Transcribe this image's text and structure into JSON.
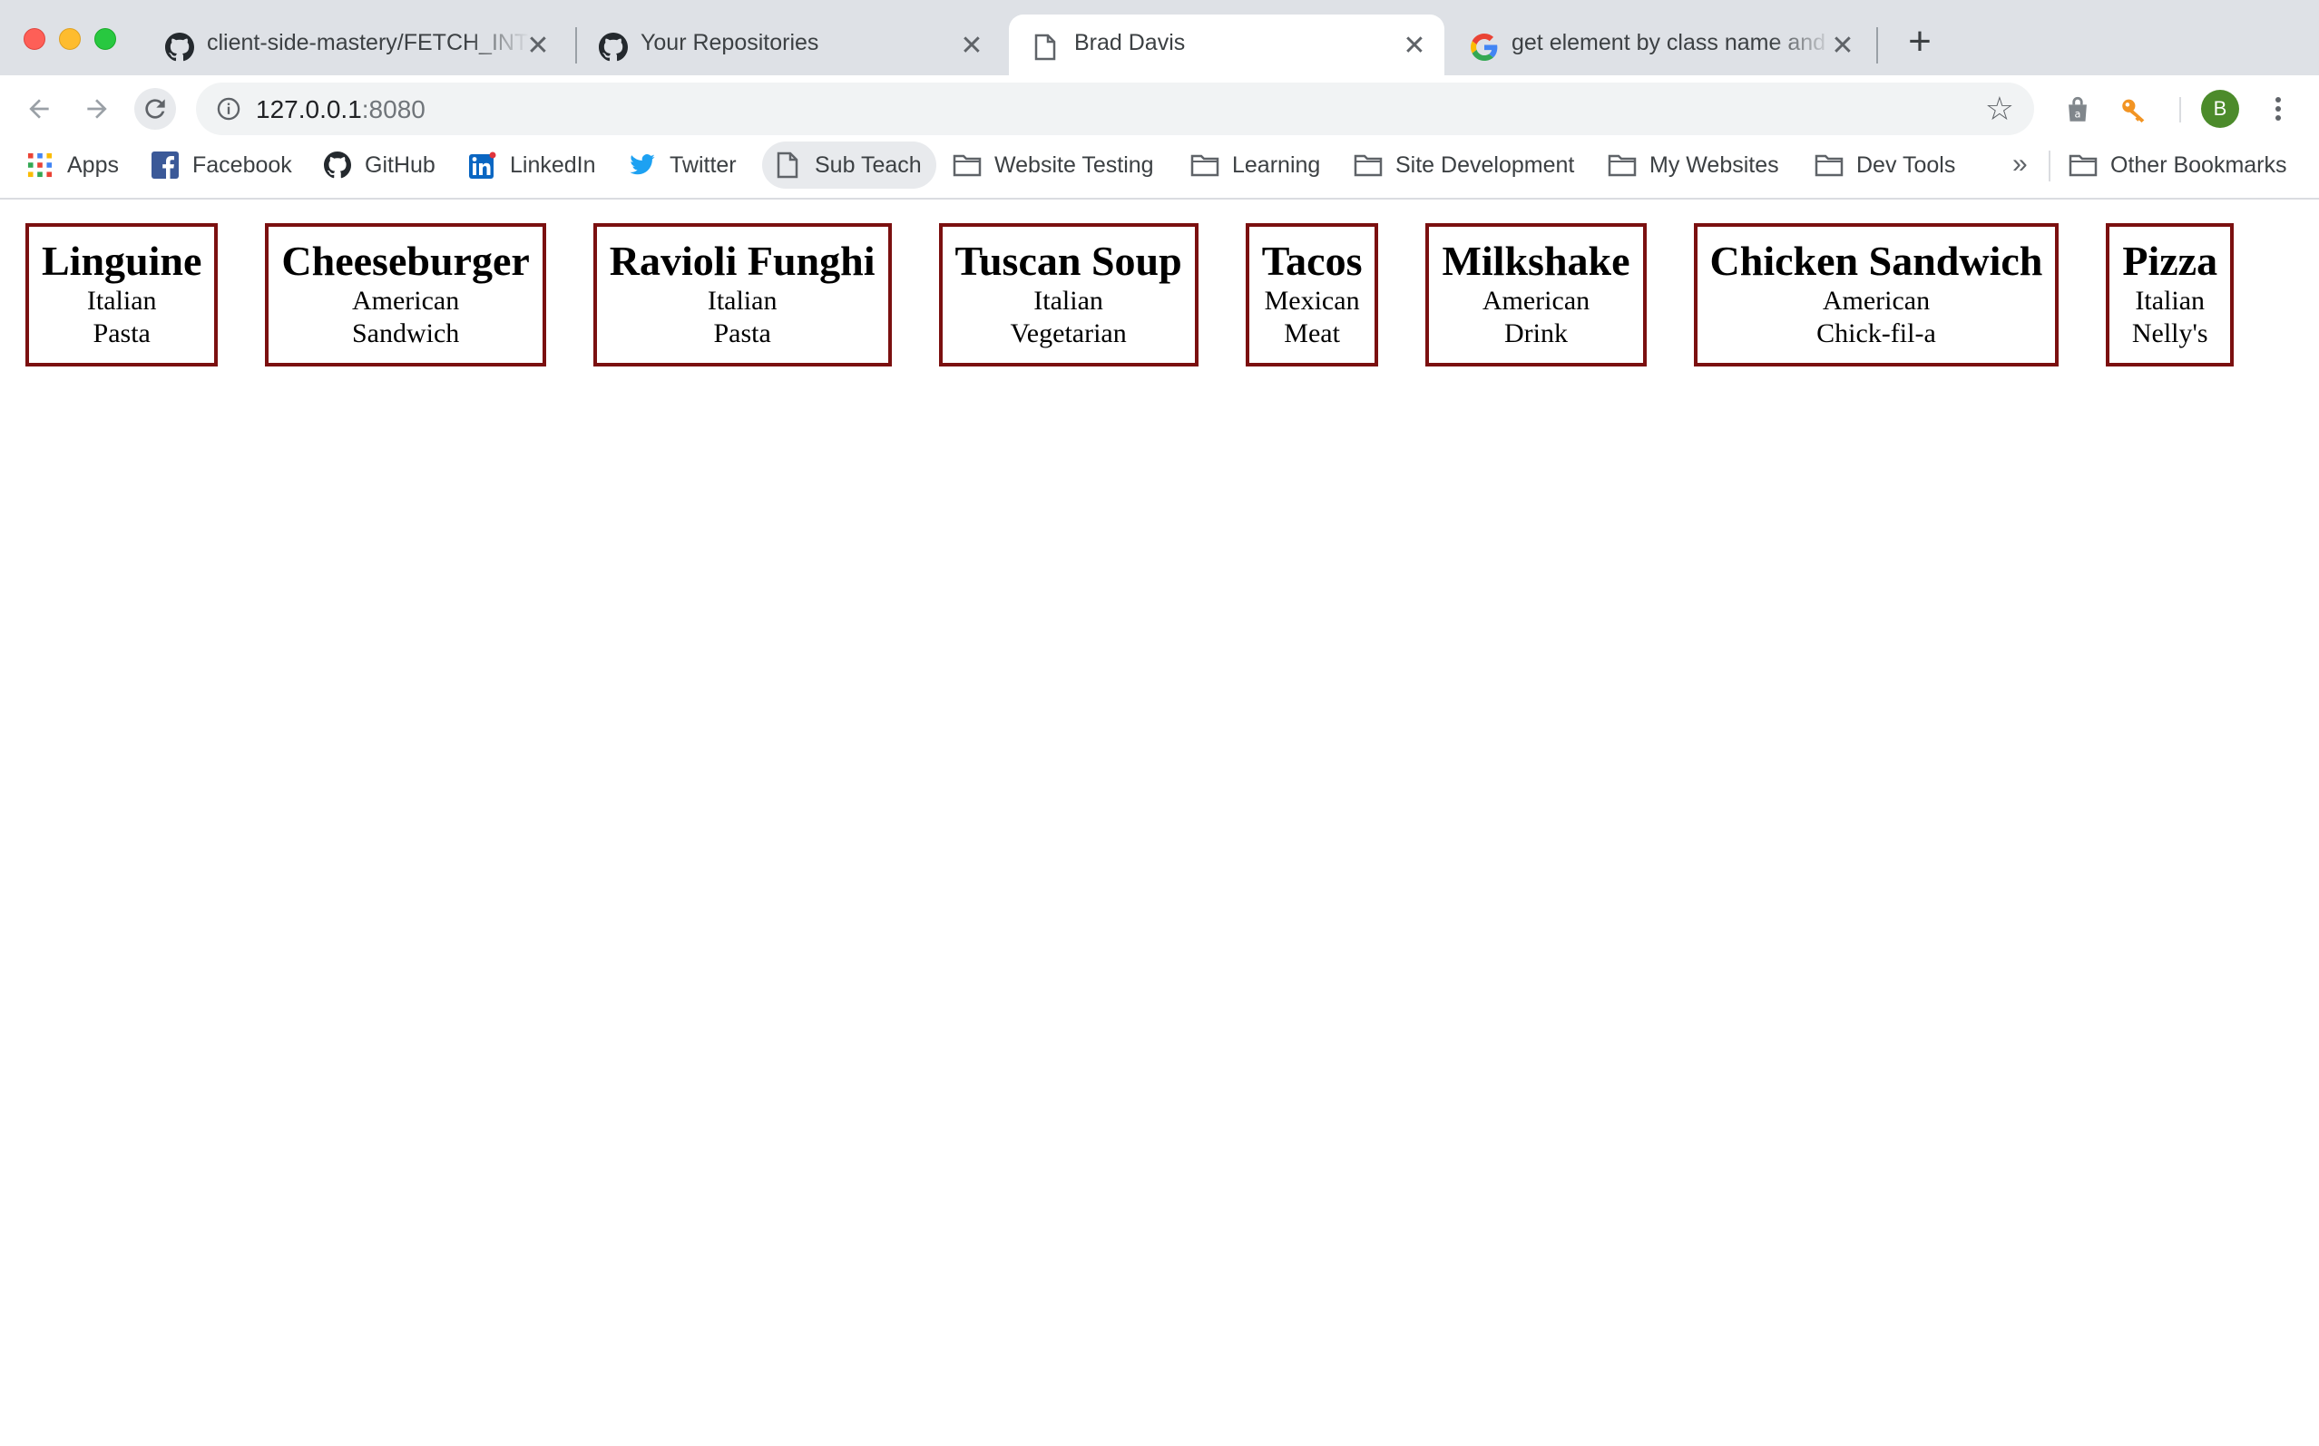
{
  "browser": {
    "tabs": [
      {
        "title": "client-side-mastery/FETCH_INTRO",
        "icon": "github-icon",
        "active": false
      },
      {
        "title": "Your Repositories",
        "icon": "github-icon",
        "active": false
      },
      {
        "title": "Brad Davis",
        "icon": "page-icon",
        "active": true
      },
      {
        "title": "get element by class name and",
        "icon": "google-icon",
        "active": false
      }
    ],
    "new_tab_label": "+",
    "close_glyph": "✕",
    "address": {
      "host": "127.0.0.1",
      "port": ":8080"
    },
    "avatar_letter": "B"
  },
  "bookmarks": {
    "items": [
      {
        "label": "Apps",
        "icon": "apps-grid-icon"
      },
      {
        "label": "Facebook",
        "icon": "facebook-icon"
      },
      {
        "label": "GitHub",
        "icon": "github-icon"
      },
      {
        "label": "LinkedIn",
        "icon": "linkedin-icon"
      },
      {
        "label": "Twitter",
        "icon": "twitter-icon"
      },
      {
        "label": "Sub Teach",
        "icon": "page-icon"
      },
      {
        "label": "Website Testing",
        "icon": "folder-icon"
      },
      {
        "label": "Learning",
        "icon": "folder-icon"
      },
      {
        "label": "Site Development",
        "icon": "folder-icon"
      },
      {
        "label": "My Websites",
        "icon": "folder-icon"
      },
      {
        "label": "Dev Tools",
        "icon": "folder-icon"
      }
    ],
    "more_glyph": "»",
    "other": {
      "label": "Other Bookmarks",
      "icon": "folder-icon"
    }
  },
  "menu": {
    "items": [
      {
        "name": "Linguine",
        "cuisine": "Italian",
        "category": "Pasta"
      },
      {
        "name": "Cheeseburger",
        "cuisine": "American",
        "category": "Sandwich"
      },
      {
        "name": "Ravioli Funghi",
        "cuisine": "Italian",
        "category": "Pasta"
      },
      {
        "name": "Tuscan Soup",
        "cuisine": "Italian",
        "category": "Vegetarian"
      },
      {
        "name": "Tacos",
        "cuisine": "Mexican",
        "category": "Meat"
      },
      {
        "name": "Milkshake",
        "cuisine": "American",
        "category": "Drink"
      },
      {
        "name": "Chicken Sandwich",
        "cuisine": "American",
        "category": "Chick-fil-a"
      },
      {
        "name": "Pizza",
        "cuisine": "Italian",
        "category": "Nelly's"
      }
    ]
  },
  "colors": {
    "card_border": "#7b1010",
    "tabstrip": "#dee1e6",
    "avatar": "#4c8b2b"
  }
}
